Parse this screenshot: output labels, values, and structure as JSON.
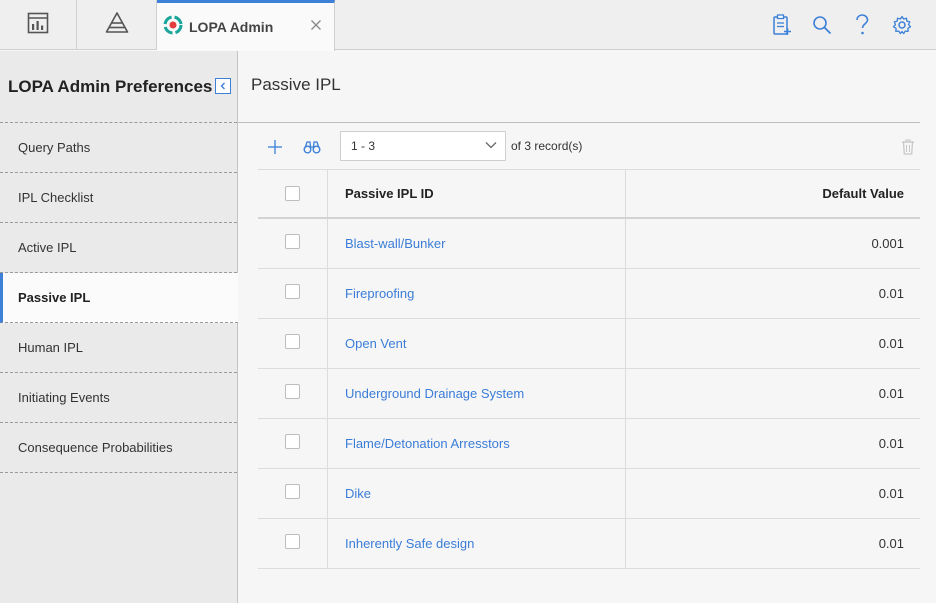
{
  "topbar": {
    "icons": [
      "dashboard-icon",
      "pyramid-icon"
    ],
    "active_tab": {
      "label": "LOPA Admin",
      "icon": "lopa-logo-icon"
    },
    "actions": [
      "clipboard-add-icon",
      "search-icon",
      "help-icon",
      "settings-gear-icon"
    ]
  },
  "sidebar": {
    "title": "LOPA Admin Preferences",
    "items": [
      {
        "label": "Query Paths"
      },
      {
        "label": "IPL Checklist"
      },
      {
        "label": "Active IPL"
      },
      {
        "label": "Passive IPL"
      },
      {
        "label": "Human IPL"
      },
      {
        "label": "Initiating Events"
      },
      {
        "label": "Consequence Probabilities"
      }
    ],
    "active_index": 3
  },
  "main": {
    "title": "Passive IPL",
    "pager": {
      "value": "1 - 3",
      "records_text": "of 3 record(s)"
    },
    "columns": {
      "id": "Passive IPL ID",
      "value": "Default Value"
    },
    "rows": [
      {
        "id": "Blast-wall/Bunker",
        "value": "0.001"
      },
      {
        "id": "Fireproofing",
        "value": "0.01"
      },
      {
        "id": "Open Vent",
        "value": "0.01"
      },
      {
        "id": "Underground Drainage System",
        "value": "0.01"
      },
      {
        "id": "Flame/Detonation Arresstors",
        "value": "0.01"
      },
      {
        "id": "Dike",
        "value": "0.01"
      },
      {
        "id": "Inherently Safe design",
        "value": "0.01"
      }
    ]
  },
  "colors": {
    "accent": "#3c80d8",
    "link": "#3b7dd8",
    "logo_teal": "#1aa59a",
    "logo_red": "#e33d3d"
  }
}
